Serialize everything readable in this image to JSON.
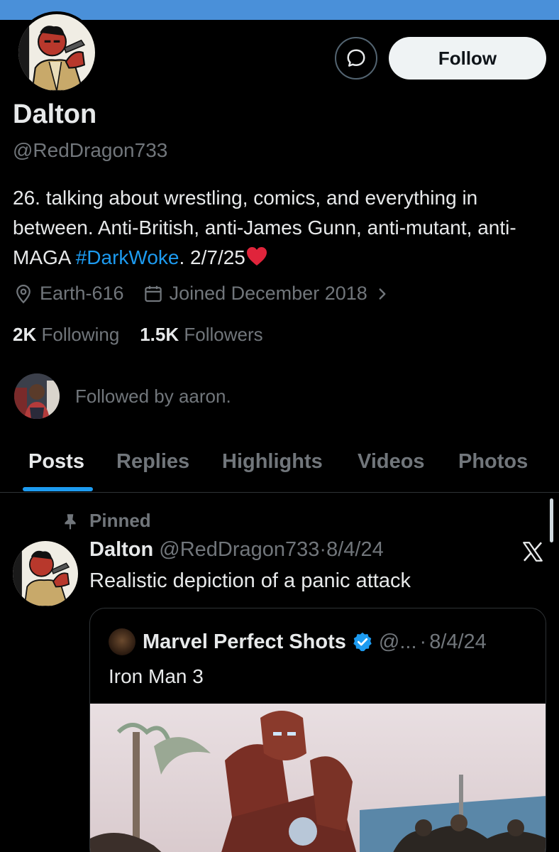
{
  "profile": {
    "display_name": "Dalton",
    "handle": "@RedDragon733",
    "bio_prefix": "26. talking about wrestling, comics, and everything in between. Anti-British, anti-James Gunn, anti-mutant, anti-MAGA ",
    "bio_hashtag": "#DarkWoke",
    "bio_suffix": ". 2/7/25",
    "location": "Earth-616",
    "joined": "Joined December 2018",
    "following_count": "2K",
    "following_label": "Following",
    "followers_count": "1.5K",
    "followers_label": "Followers",
    "followed_by": "Followed by aaron."
  },
  "actions": {
    "follow_label": "Follow"
  },
  "tabs": [
    {
      "label": "Posts",
      "active": true
    },
    {
      "label": "Replies",
      "active": false
    },
    {
      "label": "Highlights",
      "active": false
    },
    {
      "label": "Videos",
      "active": false
    },
    {
      "label": "Photos",
      "active": false
    }
  ],
  "pinned_post": {
    "pinned_label": "Pinned",
    "author_name": "Dalton",
    "author_handle": "@RedDragon733",
    "separator": "·",
    "date": "8/4/24",
    "text": "Realistic depiction of a panic attack",
    "quote": {
      "author_name": "Marvel Perfect Shots",
      "author_handle": "@...",
      "separator": "·",
      "date": "8/4/24",
      "text": "Iron Man 3"
    }
  },
  "colors": {
    "accent": "#1d9bf0",
    "background": "#000000",
    "secondary_text": "#71767b",
    "top_bar": "#4a90d9"
  },
  "icons": {
    "message": "message-circle-icon",
    "location": "location-pin-icon",
    "calendar": "calendar-icon",
    "chevron": "chevron-right-icon",
    "pin": "pin-icon",
    "x_logo": "x-logo-icon",
    "verified": "verified-badge-icon",
    "heart": "heart-emoji-icon"
  }
}
